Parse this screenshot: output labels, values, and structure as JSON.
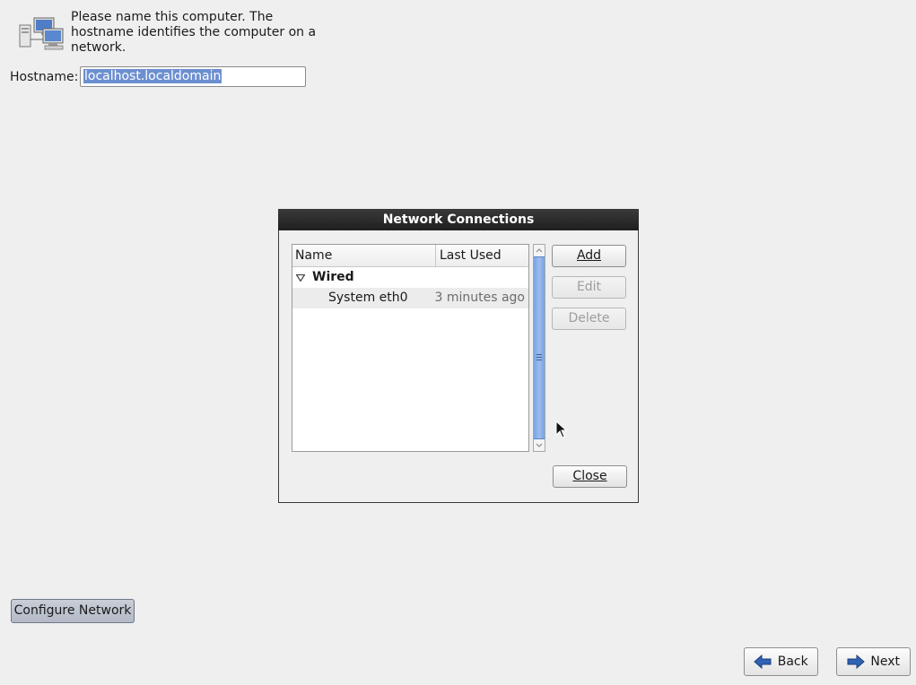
{
  "header": {
    "description": "Please name this computer.  The hostname identifies the computer on a network.",
    "icon": "network-computers-icon"
  },
  "hostname": {
    "label": "Hostname:",
    "value": "localhost.localdomain"
  },
  "dialog": {
    "title": "Network Connections",
    "columns": {
      "name": "Name",
      "last_used": "Last Used"
    },
    "group": {
      "label": "Wired",
      "expanded": true
    },
    "connections": [
      {
        "name": "System eth0",
        "last_used": "3 minutes ago"
      }
    ],
    "buttons": {
      "add": "Add",
      "edit": "Edit",
      "delete": "Delete",
      "close": "Close"
    }
  },
  "footer": {
    "configure_network": "Configure Network",
    "back": "Back",
    "next": "Next"
  },
  "colors": {
    "selection": "#6c8fd0",
    "scroll_thumb": "#7aa2e2",
    "titlebar": "#1f1f1f",
    "nav_arrow": "#2f62b4"
  }
}
